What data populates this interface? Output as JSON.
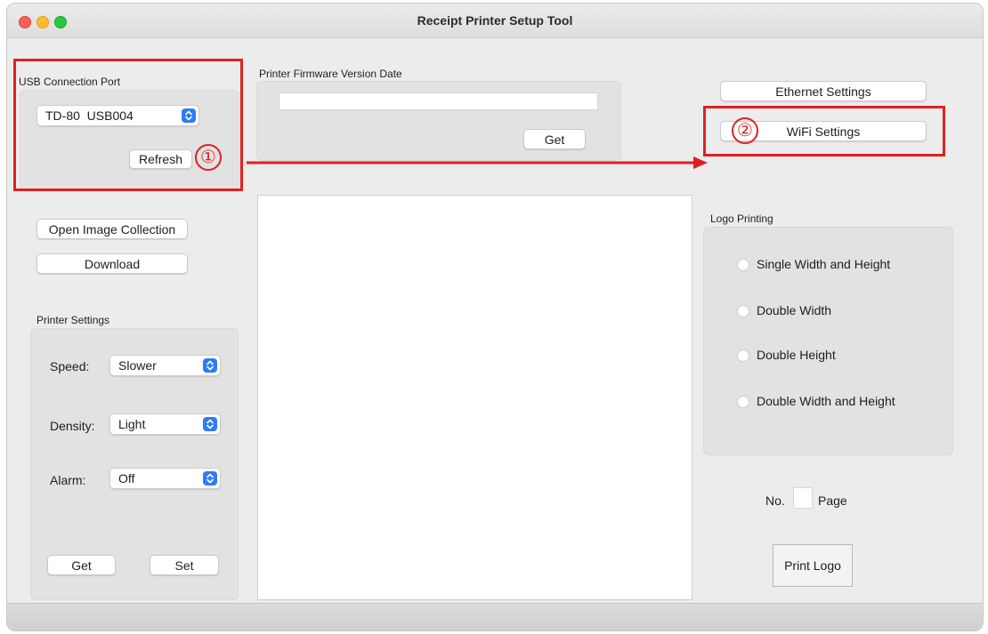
{
  "window": {
    "title": "Receipt Printer Setup Tool"
  },
  "usb": {
    "group_label": "USB Connection Port",
    "port_value": "TD-80  USB004",
    "refresh_label": "Refresh"
  },
  "firmware": {
    "group_label": "Printer Firmware Version Date",
    "value": "",
    "get_label": "Get"
  },
  "network": {
    "ethernet_label": "Ethernet Settings",
    "wifi_label": "WiFi Settings"
  },
  "annotations": {
    "step1": "①",
    "step2": "②"
  },
  "images": {
    "open_collection_label": "Open Image Collection",
    "download_label": "Download"
  },
  "printer_settings": {
    "group_label": "Printer Settings",
    "speed_label": "Speed:",
    "speed_value": "Slower",
    "density_label": "Density:",
    "density_value": "Light",
    "alarm_label": "Alarm:",
    "alarm_value": "Off",
    "get_label": "Get",
    "set_label": "Set"
  },
  "logo_printing": {
    "group_label": "Logo Printing",
    "options": [
      "Single Width and Height",
      "Double Width",
      "Double Height",
      "Double Width and Height"
    ],
    "no_label": "No.",
    "page_value": "",
    "page_label": "Page",
    "print_label": "Print Logo"
  },
  "colors": {
    "annotation_red": "#e02020",
    "accent_blue": "#2d7cf6"
  },
  "icons": [
    "select-chevron-icon",
    "close-icon",
    "minimize-icon",
    "zoom-icon",
    "arrow-icon"
  ]
}
